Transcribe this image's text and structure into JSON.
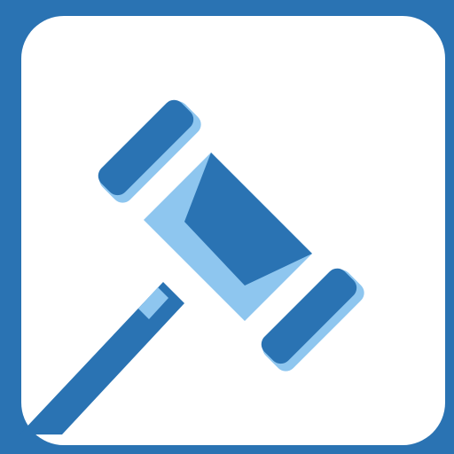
{
  "icon": {
    "name": "gavel-icon",
    "colors": {
      "frame": "#2A73B3",
      "tile": "#FFFFFF",
      "primary": "#2A73B3",
      "highlight": "#8EC6EF"
    }
  }
}
